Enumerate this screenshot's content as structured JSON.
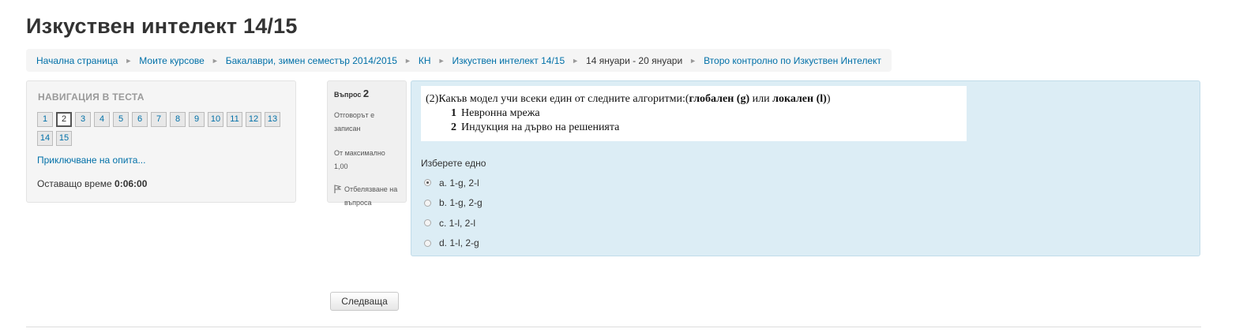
{
  "page": {
    "title": "Изкуствен интелект 14/15"
  },
  "breadcrumb": [
    {
      "label": "Начална страница",
      "link": true
    },
    {
      "label": "Моите курсове",
      "link": true
    },
    {
      "label": "Бакалаври, зимен семестър 2014/2015",
      "link": true
    },
    {
      "label": "КН",
      "link": true
    },
    {
      "label": "Изкуствен интелект 14/15",
      "link": true
    },
    {
      "label": "14 януари - 20 януари",
      "link": false
    },
    {
      "label": "Второ контролно по Изкуствен Интелект",
      "link": true
    }
  ],
  "breadcrumb_separator": "►",
  "quiz_nav": {
    "title": "НАВИГАЦИЯ В ТЕСТА",
    "questions": [
      "1",
      "2",
      "3",
      "4",
      "5",
      "6",
      "7",
      "8",
      "9",
      "10",
      "11",
      "12",
      "13",
      "14",
      "15"
    ],
    "current": "2",
    "finish_link": "Приключване на опита...",
    "timer_label": "Оставащо време",
    "timer_value": "0:06:00"
  },
  "question_info": {
    "label": "Въпрос",
    "number": "2",
    "state": "Отговорът е записан",
    "grade": "От максимално 1,00",
    "flag_label": "Отбелязване на въпроса",
    "flag_icon": "flag-icon"
  },
  "question": {
    "text_prefix": "(2)Какъв модел учи всеки един от следните алгоритми:(",
    "text_bold1": "глобален (g)",
    "text_mid": " или ",
    "text_bold2": "локален (l)",
    "text_suffix": ")",
    "items": [
      {
        "num": "1",
        "label": "Невронна мрежа"
      },
      {
        "num": "2",
        "label": "Индукция на дърво на решенията"
      }
    ],
    "prompt": "Изберете едно",
    "answers": [
      {
        "label": "a. 1-g, 2-l",
        "selected": true
      },
      {
        "label": "b. 1-g, 2-g",
        "selected": false
      },
      {
        "label": "c. 1-l, 2-l",
        "selected": false
      },
      {
        "label": "d. 1-l, 2-g",
        "selected": false
      }
    ]
  },
  "buttons": {
    "next_label": "Следваща"
  },
  "colors": {
    "link": "#0070a8",
    "question_bg": "#dcedf5",
    "panel_bg": "#f5f5f5"
  }
}
